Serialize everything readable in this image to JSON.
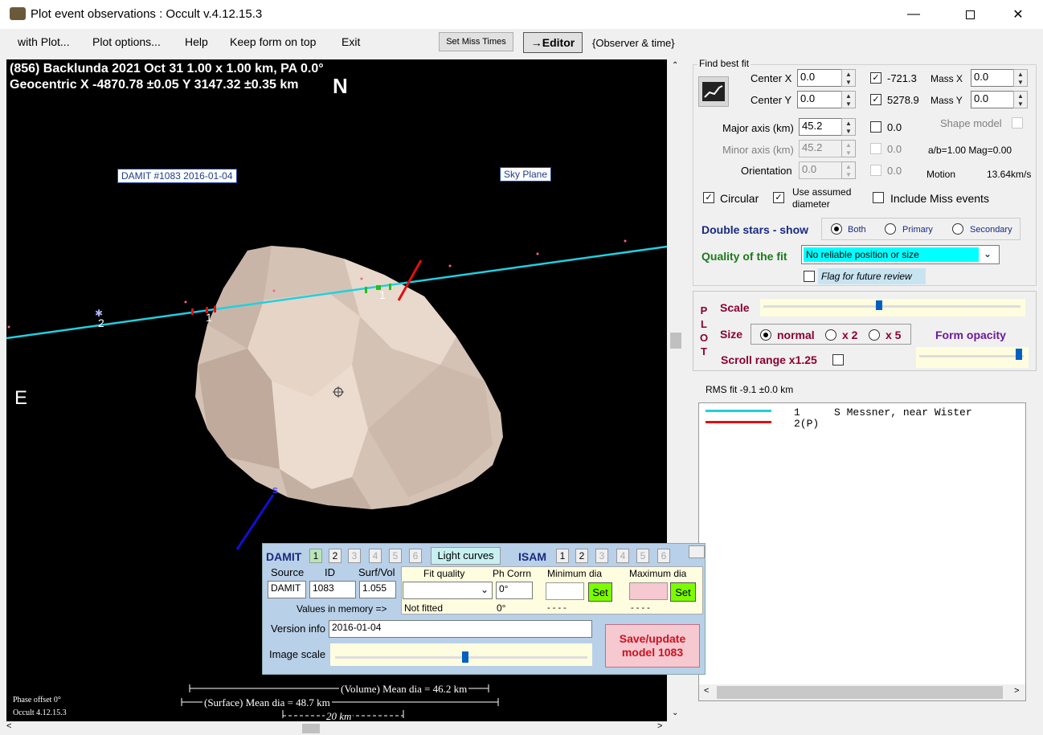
{
  "window": {
    "title": "Plot event observations : Occult v.4.12.15.3",
    "minimize_icon": "minimize-icon",
    "maximize_icon": "maximize-icon",
    "close_icon": "close-icon"
  },
  "menu": {
    "items": [
      "with Plot...",
      "Plot options...",
      "Help",
      "Keep form on top",
      "Exit"
    ],
    "set_miss_times": "Set Miss Times",
    "editor": "→Editor",
    "observer_time": "{Observer & time}"
  },
  "plot": {
    "header_line1": "(856) Backlunda  2021 Oct 31   1.00 x 1.00 km, PA 0.0°",
    "header_line2": "Geocentric  X  -4870.78 ±0.05  Y 3147.32 ±0.35 km",
    "north": "N",
    "east": "E",
    "south_marker": "S",
    "damit_tag": "DAMIT #1083 2016-01-04",
    "sky_plane_tag": "Sky Plane",
    "chord_labels": [
      "2",
      "1",
      "1"
    ],
    "volume_dia": "(Volume) Mean dia = 46.2 km",
    "surface_dia": "(Surface) Mean dia = 48.7 km",
    "scale_bar": "20 km",
    "phase_offset": "Phase offset 0°",
    "version": "Occult 4.12.15.3"
  },
  "fit": {
    "find_best_fit": "Find best fit",
    "center_x_label": "Center X",
    "center_x": "0.0",
    "center_y_label": "Center Y",
    "center_y": "0.0",
    "val_x": "-721.3",
    "val_y": "5278.9",
    "mass_x_label": "Mass X",
    "mass_x": "0.0",
    "mass_y_label": "Mass Y",
    "mass_y": "0.0",
    "major_label": "Major axis (km)",
    "major": "45.2",
    "major_chk_val": "0.0",
    "shape_model": "Shape model",
    "minor_label": "Minor axis (km)",
    "minor": "45.2",
    "minor_chk_val": "0.0",
    "ab_mag": "a/b=1.00  Mag=0.00",
    "orient_label": "Orientation",
    "orient": "0.0",
    "orient_chk_val": "0.0",
    "motion_label": "Motion",
    "motion": "13.64km/s",
    "circular": "Circular",
    "use_assumed": "Use assumed diameter",
    "include_miss": "Include Miss events",
    "double_stars": "Double stars - show",
    "both": "Both",
    "primary": "Primary",
    "secondary": "Secondary",
    "quality_label": "Quality of the fit",
    "quality": "No reliable position or size",
    "flag_review": "Flag for future review"
  },
  "plotpanel": {
    "plot_letters": [
      "P",
      "L",
      "O",
      "T"
    ],
    "scale": "Scale",
    "size": "Size",
    "normal": "normal",
    "x2": "x 2",
    "x5": "x 5",
    "form_opacity": "Form opacity",
    "scroll_range": "Scroll range x1.25"
  },
  "rms": "RMS fit -9.1 ±0.0 km",
  "list": {
    "row1_num": "1",
    "row1_name": "S Messner, near Wister",
    "row2_num": "2(P)"
  },
  "damit": {
    "label": "DAMIT",
    "nums": [
      "1",
      "2",
      "3",
      "4",
      "5",
      "6"
    ],
    "light_curves": "Light curves",
    "isam": "ISAM",
    "source_label": "Source",
    "id_label": "ID",
    "surfvol_label": "Surf/Vol",
    "source": "DAMIT",
    "id": "1083",
    "surfvol": "1.055",
    "values_mem": "Values in memory =>",
    "fit_quality_label": "Fit quality",
    "not_fitted": "Not fitted",
    "phcorr_label": "Ph Corrn",
    "phcorr": "0°",
    "phcorr_mem": "0°",
    "min_dia_label": "Minimum dia",
    "max_dia_label": "Maximum dia",
    "dashes1": "- - - -",
    "dashes2": "- - - -",
    "set": "Set",
    "version_label": "Version info",
    "version": "2016-01-04",
    "image_scale_label": "Image scale",
    "save_update": "Save/update model 1083"
  },
  "colors": {
    "chord1": "#1fd0e0",
    "chord2": "#e01010",
    "quality_bg": "#00ffff",
    "asteroid": "#d8c8bc"
  }
}
